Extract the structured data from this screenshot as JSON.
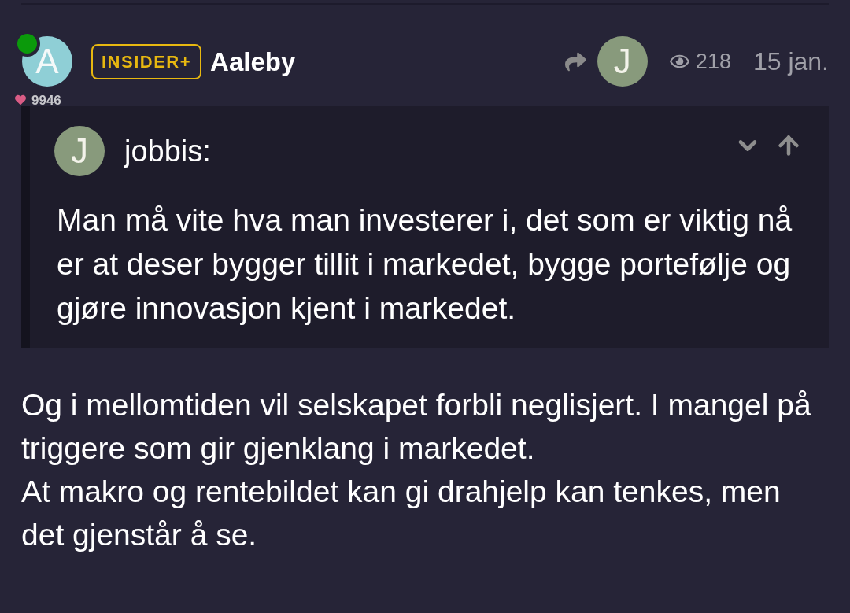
{
  "post": {
    "author": {
      "initial": "A",
      "online": true,
      "badge": "INSIDER+",
      "name": "Aaleby",
      "likes": "9946"
    },
    "reply_to": {
      "initial": "J"
    },
    "views": "218",
    "date": "15 jan.",
    "quote": {
      "initial": "J",
      "author": "jobbis:",
      "text": "Man må vite hva man investerer i, det som er viktig nå er at deser bygger tillit i markedet, bygge portefølje og gjøre innovasjon kjent i markedet."
    },
    "body": [
      "Og i mellomtiden vil selskapet forbli neglisjert. I mangel på triggere som gir gjenklang i markedet.",
      "At makro og rentebildet kan gi drahjelp kan tenkes, men det gjenstår å se."
    ]
  }
}
